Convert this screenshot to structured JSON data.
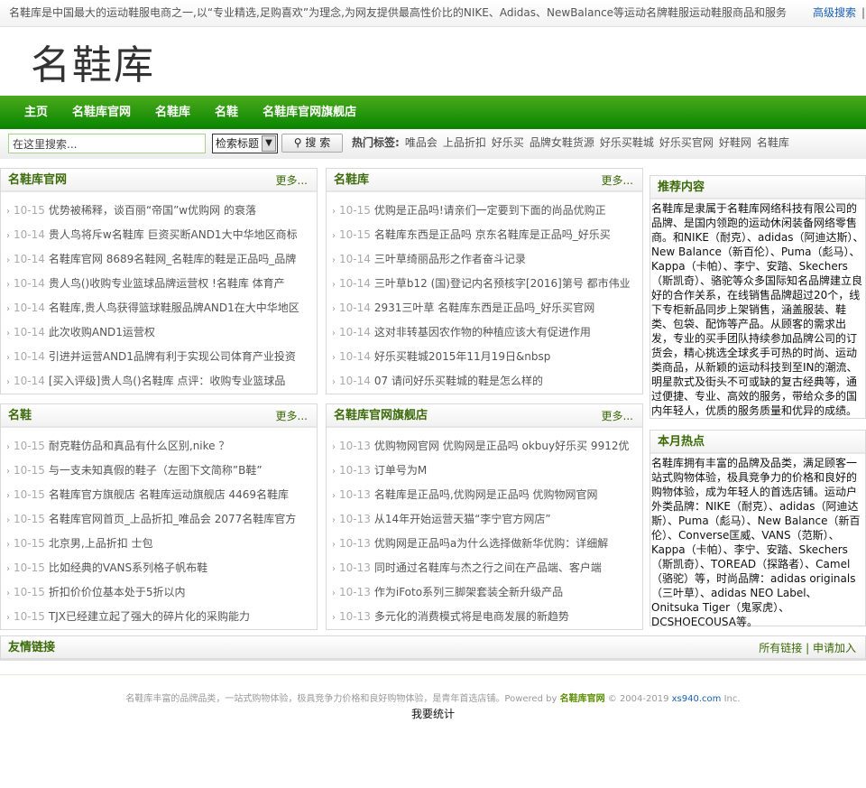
{
  "topbar": {
    "text": "名鞋库是中国最大的运动鞋服电商之一,以“专业精选,足购喜欢”为理念,为网友提供最高性价比的NIKE、Adidas、NewBalance等运动名牌鞋服运动鞋服商品和服务",
    "advanced_search": "高级搜索",
    "sep": "|"
  },
  "logo": "名鞋库",
  "nav": [
    "主页",
    "名鞋库官网",
    "名鞋库",
    "名鞋",
    "名鞋库官网旗舰店"
  ],
  "search": {
    "placeholder": "在这里搜索...",
    "select": "检索标题",
    "button": "搜 索",
    "hot_label": "热门标签:",
    "hot_tags": [
      "唯品会",
      "上品折扣",
      "好乐买",
      "品牌女鞋货源",
      "好乐买鞋城",
      "好乐买官网",
      "好鞋网",
      "名鞋库"
    ]
  },
  "more": "更多...",
  "panels": [
    {
      "title": "名鞋库官网",
      "items": [
        [
          "10-15",
          "优势被稀释，谈百丽“帝国”w优购网 的衰落"
        ],
        [
          "10-14",
          "贵人鸟将斥w名鞋库 巨资买断AND1大中华地区商标"
        ],
        [
          "10-14",
          "名鞋库官网 8689名鞋网_名鞋库的鞋是正品吗_品牌"
        ],
        [
          "10-14",
          "贵人鸟()收购专业篮球品牌运营权 !名鞋库 体育产"
        ],
        [
          "10-14",
          "名鞋库,贵人鸟获得篮球鞋服品牌AND1在大中华地区"
        ],
        [
          "10-14",
          "此次收购AND1运营权"
        ],
        [
          "10-14",
          "引进并运营AND1品牌有利于实现公司体育产业投资"
        ],
        [
          "10-14",
          "[买入评级]贵人鸟()名鞋库 点评：收购专业篮球品"
        ]
      ]
    },
    {
      "title": "名鞋库",
      "items": [
        [
          "10-15",
          "优购是正品吗!请亲们一定要到下面的尚品优购正"
        ],
        [
          "10-15",
          "名鞋库东西是正品吗 京东名鞋库是正品吗_好乐买"
        ],
        [
          "10-14",
          "三叶草绮丽品形之作者奋斗记录"
        ],
        [
          "10-14",
          "三叶草b12 (国)登记内名预核字[2016]第号 都市伟业"
        ],
        [
          "10-14",
          "2931三叶草 名鞋库东西是正品吗_好乐买官网"
        ],
        [
          "10-14",
          "这对非转基因农作物的种植应该大有促进作用"
        ],
        [
          "10-14",
          "好乐买鞋城2015年11月19日&nbsp"
        ],
        [
          "10-14",
          "07 请问好乐买鞋城的鞋是怎么样的"
        ]
      ]
    },
    {
      "title": "名鞋",
      "items": [
        [
          "10-15",
          "耐克鞋仿品和真品有什么区别,nike ？"
        ],
        [
          "10-15",
          "与一支未知真假的鞋子（左图下文简称”B鞋”"
        ],
        [
          "10-15",
          "名鞋库官方旗舰店 名鞋库运动旗舰店 4469名鞋库"
        ],
        [
          "10-15",
          "名鞋库官网首页_上品折扣_唯品会 2077名鞋库官方"
        ],
        [
          "10-15",
          "北京男,上品折扣 士包"
        ],
        [
          "10-15",
          "比如经典的VANS系列格子帆布鞋"
        ],
        [
          "10-15",
          "折扣价价位基本处于5折以内"
        ],
        [
          "10-15",
          "TJX已经建立起了强大的碎片化的采购能力"
        ]
      ]
    },
    {
      "title": "名鞋库官网旗舰店",
      "items": [
        [
          "10-13",
          "优购物网官网 优购网是正品吗 okbuy好乐买 9912优"
        ],
        [
          "10-13",
          "订单号为M"
        ],
        [
          "10-13",
          "名鞋库是正品吗,优购网是正品吗 优购物网官网"
        ],
        [
          "10-13",
          "从14年开始运营天猫“李宁官方网店”"
        ],
        [
          "10-13",
          "优购网是正品吗a为什么选择做新华优购：详细解"
        ],
        [
          "10-13",
          "同时通过名鞋库与杰之行之间在产品端、客户端"
        ],
        [
          "10-13",
          "作为iFoto系列三脚架套装全新升级产品"
        ],
        [
          "10-13",
          "多元化的消费模式将是电商发展的新趋势"
        ]
      ]
    }
  ],
  "side": [
    {
      "title": "推荐内容",
      "text": "名鞋库是隶属于名鞋库网络科技有限公司的品牌、是国内领跑的运动休闲装备网络零售商。和NIKE（耐克）、adidas（阿迪达斯）、New Balance（新百伦）、Puma（彪马）、Kappa（卡帕）、李宁、安踏、Skechers（斯凯奇）、骆驼等众多国际知名品牌建立良好的合作关系，在线销售品牌超过20个，线下专柜新品同步上架销售，涵盖服装、鞋类、包袋、配饰等产品。从顾客的需求出发，专业的买手团队持续参加品牌公司的订货会，精心挑选全球炙手可热的时尚、运动类商品，从新颖的运动科技到至IN的潮流、明星款式及街头不可或缺的复古经典等，通过便捷、专业、高效的服务，带给众多的国内年轻人，优质的服务质量和优异的成绩。"
    },
    {
      "title": "本月热点",
      "text": "名鞋库拥有丰富的品牌及品类，满足顾客一站式购物体验，极具竞争力的价格和良好的购物体验，成为年轻人的首选店铺。运动户外类品牌：NIKE（耐克）、adidas（阿迪达斯）、Puma（彪马）、New Balance（新百伦）、Converse匡威、VANS（范斯）、Kappa（卡帕）、李宁、安踏、Skechers（斯凯奇）、TOREAD（探路者）、Camel（骆驼）等，时尚品牌：adidas originals（三叶草）、adidas NEO Label、Onitsuka Tiger（鬼冢虎）、DCSHOECOUSA等。"
    }
  ],
  "links": {
    "title": "友情链接",
    "all": "所有链接",
    "sep": "|",
    "apply": "申请加入"
  },
  "footer": {
    "text": "名鞋库丰富的品牌品类，一站式购物体验，极具竞争力价格和良好购物体验，是青年首选店铺。Powered by",
    "brand": "名鞋库官网",
    "copy": "© 2004-2019",
    "domain": "xs940.com",
    "inc": "Inc.",
    "stat": "我要统计"
  }
}
